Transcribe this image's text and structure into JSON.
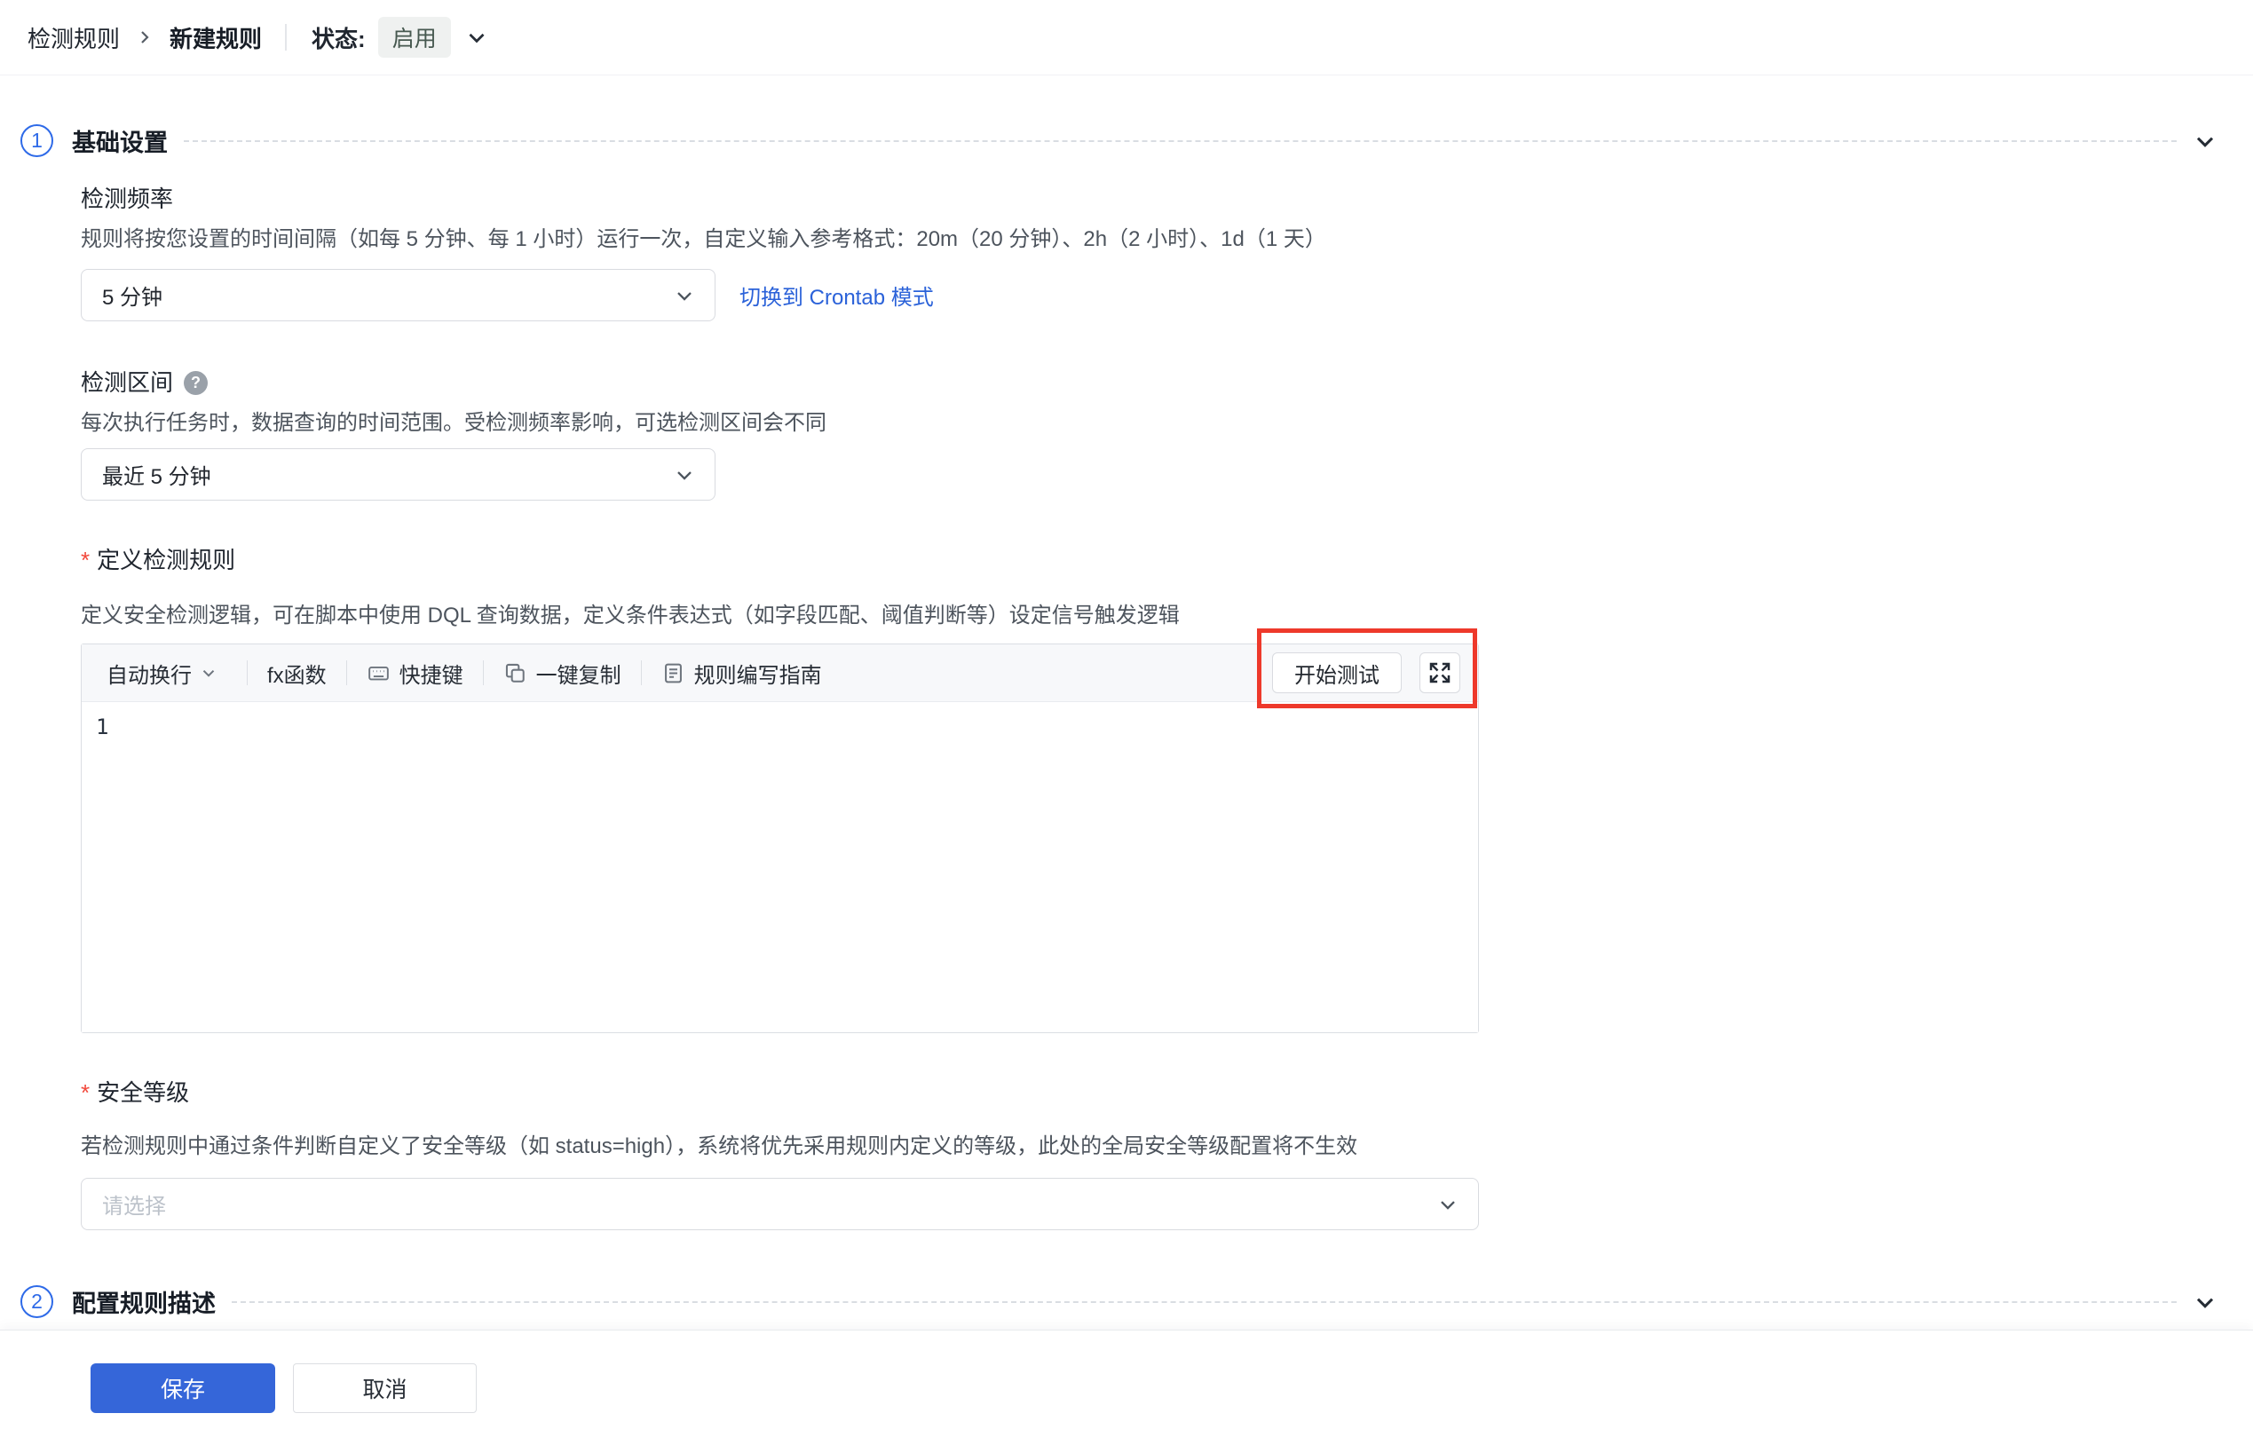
{
  "required_marker": "*",
  "colors": {
    "accent_blue": "#2b62d9",
    "step_circle_blue": "#2e6ae8",
    "save_button_blue": "#3566d9",
    "annotation_red": "#ee392b",
    "badge_bg": "#eff1f0",
    "badge_text": "#46584f",
    "toolbar_bg": "#f7f8fa",
    "input_border": "#d9dbe0"
  },
  "icons": {
    "help_glyph": "?",
    "breadcrumb_separator": "chevron-right",
    "status_chevron": "chevron-down",
    "section_collapse": "chevron-down",
    "select_chevron": "chevron-down",
    "wrap_chevron": "chevron-down",
    "shortcut_icon": "keyboard",
    "copy_icon": "copy",
    "guide_icon": "document",
    "fullscreen_icon": "expand-arrows"
  },
  "breadcrumb": {
    "root": "检测规则",
    "current": "新建规则"
  },
  "status": {
    "label": "状态:",
    "value": "启用"
  },
  "section1": {
    "number": "1",
    "title": "基础设置",
    "frequency": {
      "label": "检测频率",
      "desc": "规则将按您设置的时间间隔（如每 5 分钟、每 1 小时）运行一次，自定义输入参考格式：20m（20 分钟）、2h（2 小时）、1d（1 天）",
      "value": "5 分钟",
      "link": "切换到 Crontab 模式"
    },
    "interval": {
      "label": "检测区间",
      "desc": "每次执行任务时，数据查询的时间范围。受检测频率影响，可选检测区间会不同",
      "value": "最近 5 分钟"
    },
    "rule": {
      "label": "定义检测规则",
      "desc": "定义安全检测逻辑，可在脚本中使用 DQL 查询数据，定义条件表达式（如字段匹配、阈值判断等）设定信号触发逻辑",
      "toolbar": {
        "wrap": "自动换行",
        "fx": "fx函数",
        "shortcut": "快捷键",
        "copy": "一键复制",
        "guide": "规则编写指南",
        "test": "开始测试"
      },
      "line_number": "1"
    },
    "severity": {
      "label": "安全等级",
      "desc": "若检测规则中通过条件判断自定义了安全等级（如 status=high），系统将优先采用规则内定义的等级，此处的全局安全等级配置将不生效",
      "placeholder": "请选择"
    }
  },
  "section2": {
    "number": "2",
    "title": "配置规则描述"
  },
  "footer": {
    "save": "保存",
    "cancel": "取消"
  }
}
